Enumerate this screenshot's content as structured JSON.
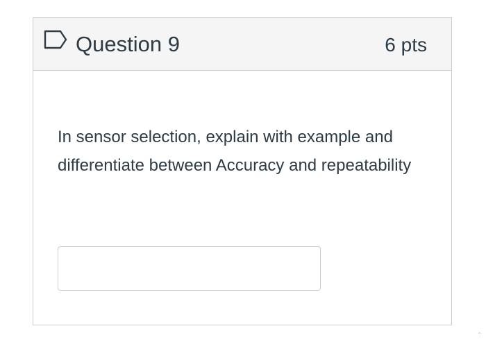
{
  "question": {
    "title": "Question 9",
    "points": "6 pts",
    "prompt": "In sensor selection, explain with example and differentiate between Accuracy and repeatability",
    "flag_icon": "bookmark-outline-icon"
  },
  "answer": {
    "value": "",
    "placeholder": ""
  },
  "scrollbar": {
    "caret_icon": "scroll-up-caret-icon",
    "glyph": "⌃"
  },
  "colors": {
    "text": "#2d3b45",
    "header_bg": "#f5f5f5",
    "border": "#c7cdd1"
  }
}
